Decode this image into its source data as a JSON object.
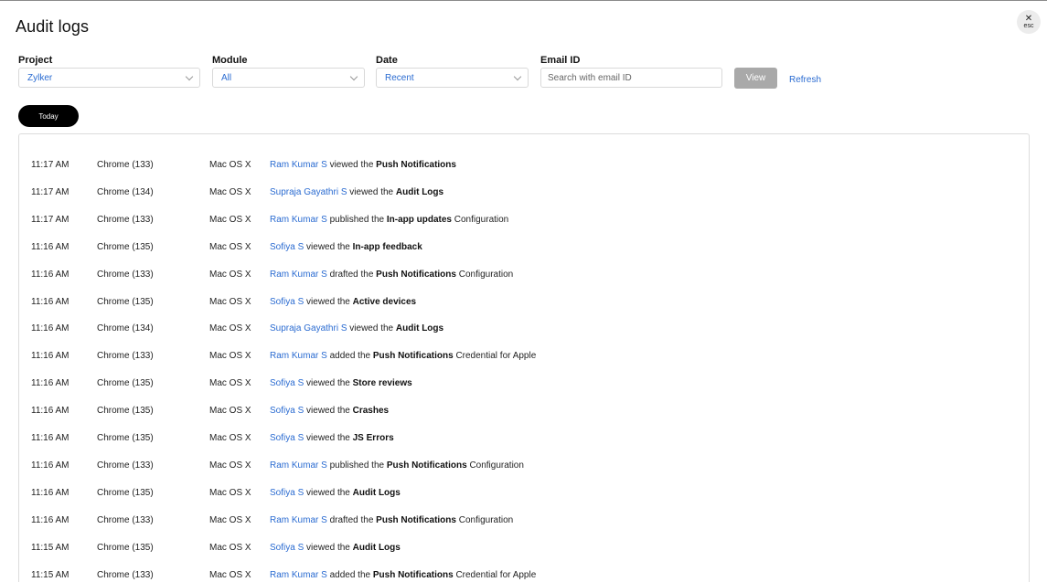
{
  "title": "Audit logs",
  "close": {
    "icon": "close-icon",
    "label": "esc"
  },
  "filters": {
    "project": {
      "label": "Project",
      "value": "Zylker"
    },
    "module": {
      "label": "Module",
      "value": "All"
    },
    "date": {
      "label": "Date",
      "value": "Recent"
    },
    "email": {
      "label": "Email ID",
      "placeholder": "Search with email ID",
      "value": ""
    }
  },
  "actions": {
    "view": "View",
    "refresh": "Refresh"
  },
  "day_group": "Today",
  "colors": {
    "link": "#2a6bd1",
    "view_button_bg": "#a9a9a9",
    "pill_bg": "#000000"
  },
  "logs": [
    {
      "time": "11:17 AM",
      "browser": "Chrome (133)",
      "os": "Mac OS X",
      "user": "Ram Kumar S",
      "action": "viewed the",
      "target": "Push Notifications",
      "suffix": ""
    },
    {
      "time": "11:17 AM",
      "browser": "Chrome (134)",
      "os": "Mac OS X",
      "user": "Supraja Gayathri S",
      "action": "viewed the",
      "target": "Audit Logs",
      "suffix": ""
    },
    {
      "time": "11:17 AM",
      "browser": "Chrome (133)",
      "os": "Mac OS X",
      "user": "Ram Kumar S",
      "action": "published the",
      "target": "In-app updates",
      "suffix": "Configuration"
    },
    {
      "time": "11:16 AM",
      "browser": "Chrome (135)",
      "os": "Mac OS X",
      "user": "Sofiya S",
      "action": "viewed the",
      "target": "In-app feedback",
      "suffix": ""
    },
    {
      "time": "11:16 AM",
      "browser": "Chrome (133)",
      "os": "Mac OS X",
      "user": "Ram Kumar S",
      "action": "drafted the",
      "target": "Push Notifications",
      "suffix": "Configuration"
    },
    {
      "time": "11:16 AM",
      "browser": "Chrome (135)",
      "os": "Mac OS X",
      "user": "Sofiya S",
      "action": "viewed the",
      "target": "Active devices",
      "suffix": ""
    },
    {
      "time": "11:16 AM",
      "browser": "Chrome (134)",
      "os": "Mac OS X",
      "user": "Supraja Gayathri S",
      "action": "viewed the",
      "target": "Audit Logs",
      "suffix": ""
    },
    {
      "time": "11:16 AM",
      "browser": "Chrome (133)",
      "os": "Mac OS X",
      "user": "Ram Kumar S",
      "action": "added the",
      "target": "Push Notifications",
      "suffix": "Credential for Apple"
    },
    {
      "time": "11:16 AM",
      "browser": "Chrome (135)",
      "os": "Mac OS X",
      "user": "Sofiya S",
      "action": "viewed the",
      "target": "Store reviews",
      "suffix": ""
    },
    {
      "time": "11:16 AM",
      "browser": "Chrome (135)",
      "os": "Mac OS X",
      "user": "Sofiya S",
      "action": "viewed the",
      "target": "Crashes",
      "suffix": ""
    },
    {
      "time": "11:16 AM",
      "browser": "Chrome (135)",
      "os": "Mac OS X",
      "user": "Sofiya S",
      "action": "viewed the",
      "target": "JS Errors",
      "suffix": ""
    },
    {
      "time": "11:16 AM",
      "browser": "Chrome (133)",
      "os": "Mac OS X",
      "user": "Ram Kumar S",
      "action": "published the",
      "target": "Push Notifications",
      "suffix": "Configuration"
    },
    {
      "time": "11:16 AM",
      "browser": "Chrome (135)",
      "os": "Mac OS X",
      "user": "Sofiya S",
      "action": "viewed the",
      "target": "Audit Logs",
      "suffix": ""
    },
    {
      "time": "11:16 AM",
      "browser": "Chrome (133)",
      "os": "Mac OS X",
      "user": "Ram Kumar S",
      "action": "drafted the",
      "target": "Push Notifications",
      "suffix": "Configuration"
    },
    {
      "time": "11:15 AM",
      "browser": "Chrome (135)",
      "os": "Mac OS X",
      "user": "Sofiya S",
      "action": "viewed the",
      "target": "Audit Logs",
      "suffix": ""
    },
    {
      "time": "11:15 AM",
      "browser": "Chrome (133)",
      "os": "Mac OS X",
      "user": "Ram Kumar S",
      "action": "added the",
      "target": "Push Notifications",
      "suffix": "Credential for Apple"
    }
  ]
}
